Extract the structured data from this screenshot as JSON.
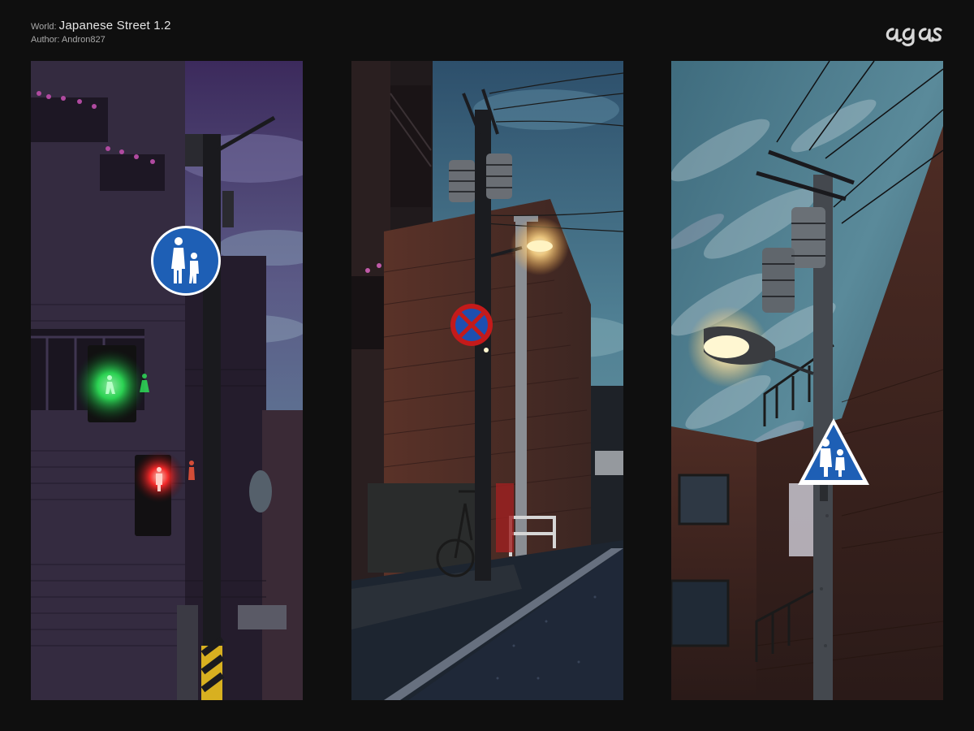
{
  "header": {
    "world_label": "World:",
    "world_value": "Japanese Street 1.2",
    "author_label": "Author:",
    "author_value": "Andron827"
  },
  "logo": {
    "text": "agas",
    "icon": "brand-logo-icon"
  },
  "panels": [
    {
      "scene": "traffic-signal-pole",
      "signals": [
        "pedestrian-green",
        "pedestrian-red"
      ],
      "sign": "pedestrian-only-sign"
    },
    {
      "scene": "street-lamp-alley",
      "sign": "no-parking-sign",
      "objects": [
        "bicycle",
        "guard-rail"
      ]
    },
    {
      "scene": "street-lamp-pole",
      "sign": "school-crossing-sign"
    }
  ],
  "colors": {
    "background": "#0f0f0f",
    "signal_green": "#2ee85a",
    "signal_red": "#ff2a2a",
    "lamp_glow": "#ffe7a8",
    "sign_blue": "#1e5fb5"
  }
}
